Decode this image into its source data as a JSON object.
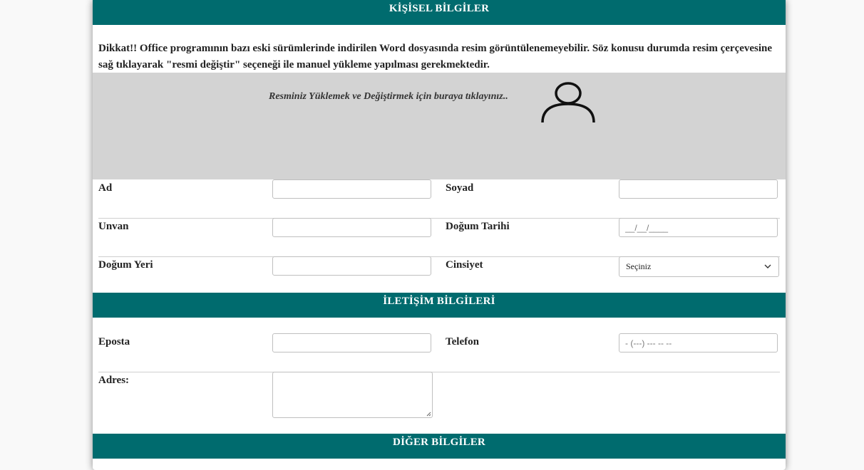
{
  "sections": {
    "personal": "KİŞİSEL BİLGİLER",
    "contact": "İLETİŞİM BİLGİLERİ",
    "other": "DİĞER BİLGİLER"
  },
  "warning": {
    "line1": "Dikkat!! Office programının bazı eski sürümlerinde indirilen Word dosyasında resim görüntülenemeyebilir. Söz konusu durumda resim çerçevesine",
    "line2": "sağ tıklayarak \"resmi değiştir\" seçeneği ile manuel yükleme yapılması gerekmektedir."
  },
  "photo": {
    "prompt": "Resminiz Yüklemek ve Değiştirmek için buraya tıklayınız..",
    "icon": "user-icon"
  },
  "personal_fields": {
    "ad": "Ad",
    "soyad": "Soyad",
    "unvan": "Unvan",
    "dogum_tarihi": "Doğum Tarihi",
    "dogum_tarihi_placeholder": "__/__/____",
    "dogum_yeri": "Doğum Yeri",
    "cinsiyet": "Cinsiyet",
    "cinsiyet_selected": "Seçiniz"
  },
  "contact_fields": {
    "eposta": "Eposta",
    "telefon": "Telefon",
    "telefon_placeholder": "- (---) --- -- --",
    "adres": "Adres:"
  },
  "colors": {
    "header_bg": "#006b6e",
    "photo_bg": "#d3d3d3",
    "page_bg": "#f9f9f9"
  }
}
